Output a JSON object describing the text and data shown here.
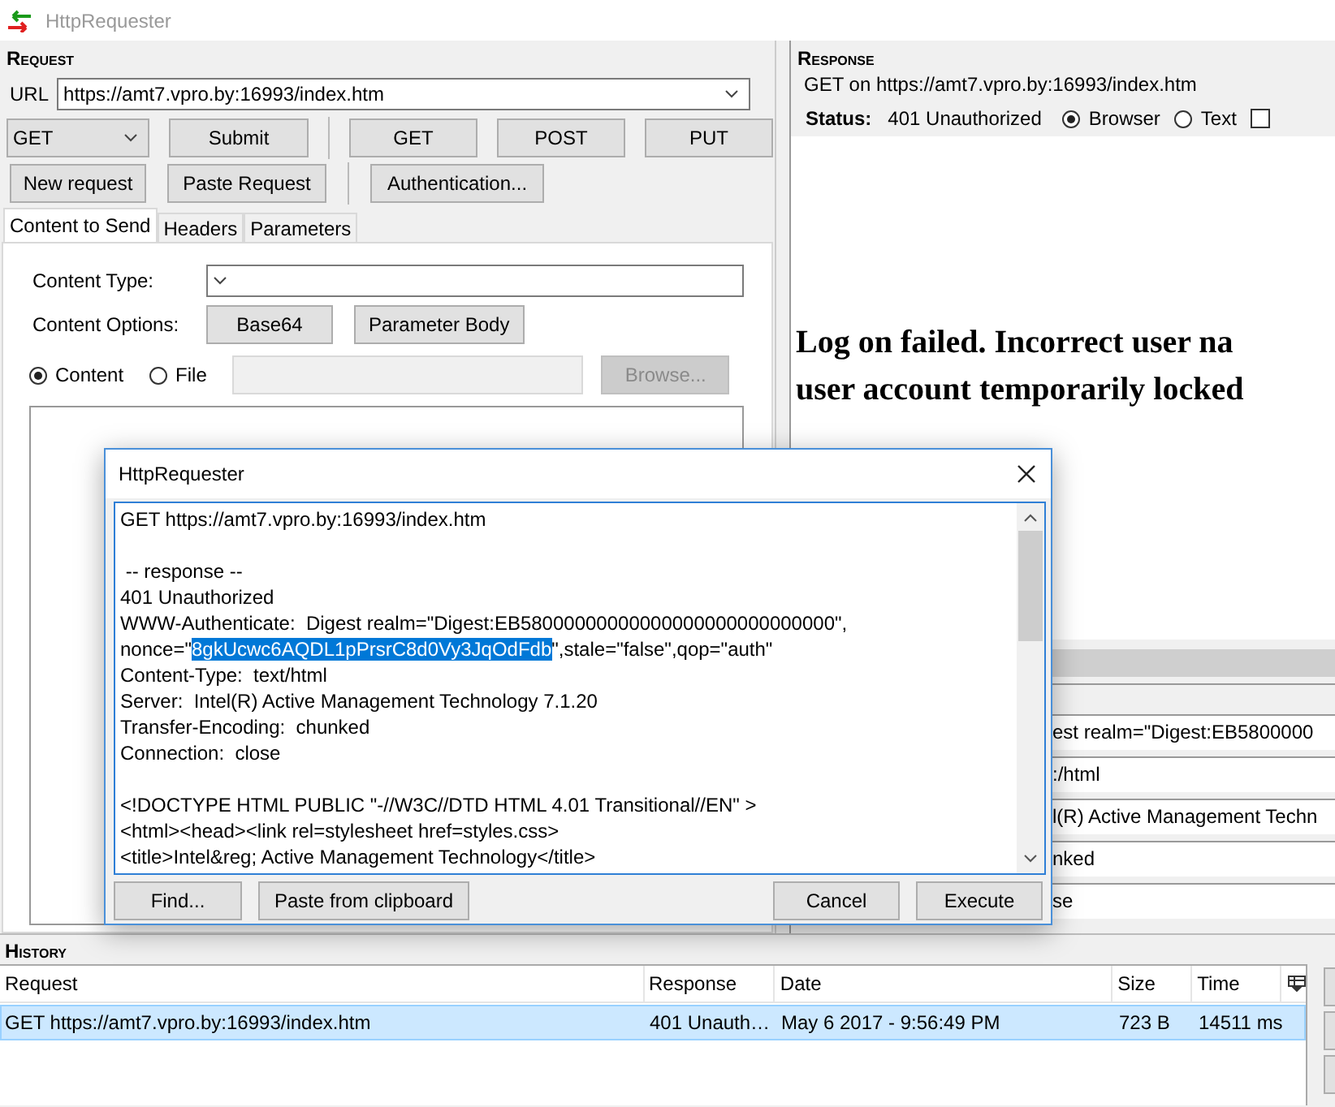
{
  "window": {
    "title": "HttpRequester"
  },
  "request": {
    "label": "Request",
    "url_label": "URL",
    "url": "https://amt7.vpro.by:16993/index.htm",
    "method": "GET",
    "buttons": [
      {
        "label": "Submit",
        "kind": "action"
      },
      {
        "label": "GET",
        "kind": "method"
      },
      {
        "label": "POST",
        "kind": "method"
      },
      {
        "label": "PUT",
        "kind": "method"
      }
    ],
    "buttons_2": [
      "New request",
      "Paste Request",
      "Authentication..."
    ],
    "tabs": [
      {
        "label": "Content to Send",
        "selected": true
      },
      {
        "label": "Headers",
        "selected": false
      },
      {
        "label": "Parameters",
        "selected": false
      }
    ],
    "content_type_label": "Content Type:",
    "content_options_label": "Content Options:",
    "content_options": [
      "Base64",
      "Parameter Body"
    ],
    "sources": [
      {
        "label": "Content",
        "selected": true
      },
      {
        "label": "File",
        "selected": false
      }
    ],
    "browse": {
      "label": "Browse...",
      "disabled": true
    }
  },
  "response": {
    "label": "Response",
    "summary": "GET on https://amt7.vpro.by:16993/index.htm",
    "status_label": "Status:",
    "status": "401 Unauthorized",
    "views": [
      {
        "label": "Browser",
        "selected": true
      },
      {
        "label": "Text",
        "selected": false
      }
    ],
    "checkbox": {
      "checked": false
    },
    "body_lines": [
      "Log on failed. Incorrect user na",
      "user account temporarily locked"
    ],
    "header_values": [
      "est realm=\"Digest:EB5800000",
      ":/html",
      "l(R) Active Management Techn",
      "nked",
      "se"
    ]
  },
  "dialog": {
    "title": "HttpRequester",
    "lines": [
      {
        "kind": "text",
        "segments": [
          {
            "text": "GET https://amt7.vpro.by:16993/index.htm",
            "selected": false
          }
        ]
      },
      {
        "kind": "blank"
      },
      {
        "kind": "text",
        "segments": [
          {
            "text": " -- response --",
            "selected": false
          }
        ]
      },
      {
        "kind": "text",
        "segments": [
          {
            "text": "401 Unauthorized",
            "selected": false
          }
        ]
      },
      {
        "kind": "text",
        "segments": [
          {
            "text": "WWW-Authenticate:  Digest realm=\"Digest:EB58000000000000000000000000000\",",
            "selected": false
          }
        ]
      },
      {
        "kind": "text",
        "segments": [
          {
            "text": "nonce=\"",
            "selected": false
          },
          {
            "text": "8gkUcwc6AQDL1pPrsrC8d0Vy3JqOdFdb",
            "selected": true
          },
          {
            "text": "\",stale=\"false\",qop=\"auth\"",
            "selected": false
          }
        ]
      },
      {
        "kind": "text",
        "segments": [
          {
            "text": "Content-Type:  text/html",
            "selected": false
          }
        ]
      },
      {
        "kind": "text",
        "segments": [
          {
            "text": "Server:  Intel(R) Active Management Technology 7.1.20",
            "selected": false
          }
        ]
      },
      {
        "kind": "text",
        "segments": [
          {
            "text": "Transfer-Encoding:  chunked",
            "selected": false
          }
        ]
      },
      {
        "kind": "text",
        "segments": [
          {
            "text": "Connection:  close",
            "selected": false
          }
        ]
      },
      {
        "kind": "blank"
      },
      {
        "kind": "text",
        "segments": [
          {
            "text": "<!DOCTYPE HTML PUBLIC \"-//W3C//DTD HTML 4.01 Transitional//EN\" >",
            "selected": false
          }
        ]
      },
      {
        "kind": "text",
        "segments": [
          {
            "text": "<html><head><link rel=stylesheet href=styles.css>",
            "selected": false
          }
        ]
      },
      {
        "kind": "text",
        "segments": [
          {
            "text": "<title>Intel&reg; Active Management Technology</title>",
            "selected": false
          }
        ]
      }
    ],
    "left_buttons": [
      "Find...",
      "Paste from clipboard"
    ],
    "right_buttons": [
      "Cancel",
      "Execute"
    ]
  },
  "history": {
    "label": "History",
    "columns": [
      "Request",
      "Response",
      "Date",
      "Size",
      "Time"
    ],
    "rows": [
      {
        "cells": [
          "GET https://amt7.vpro.by:16993/index.htm",
          "401 Unauth…",
          "May 6 2017 - 9:56:49 PM",
          "723 B",
          "14511 ms"
        ],
        "selected": true
      }
    ]
  }
}
